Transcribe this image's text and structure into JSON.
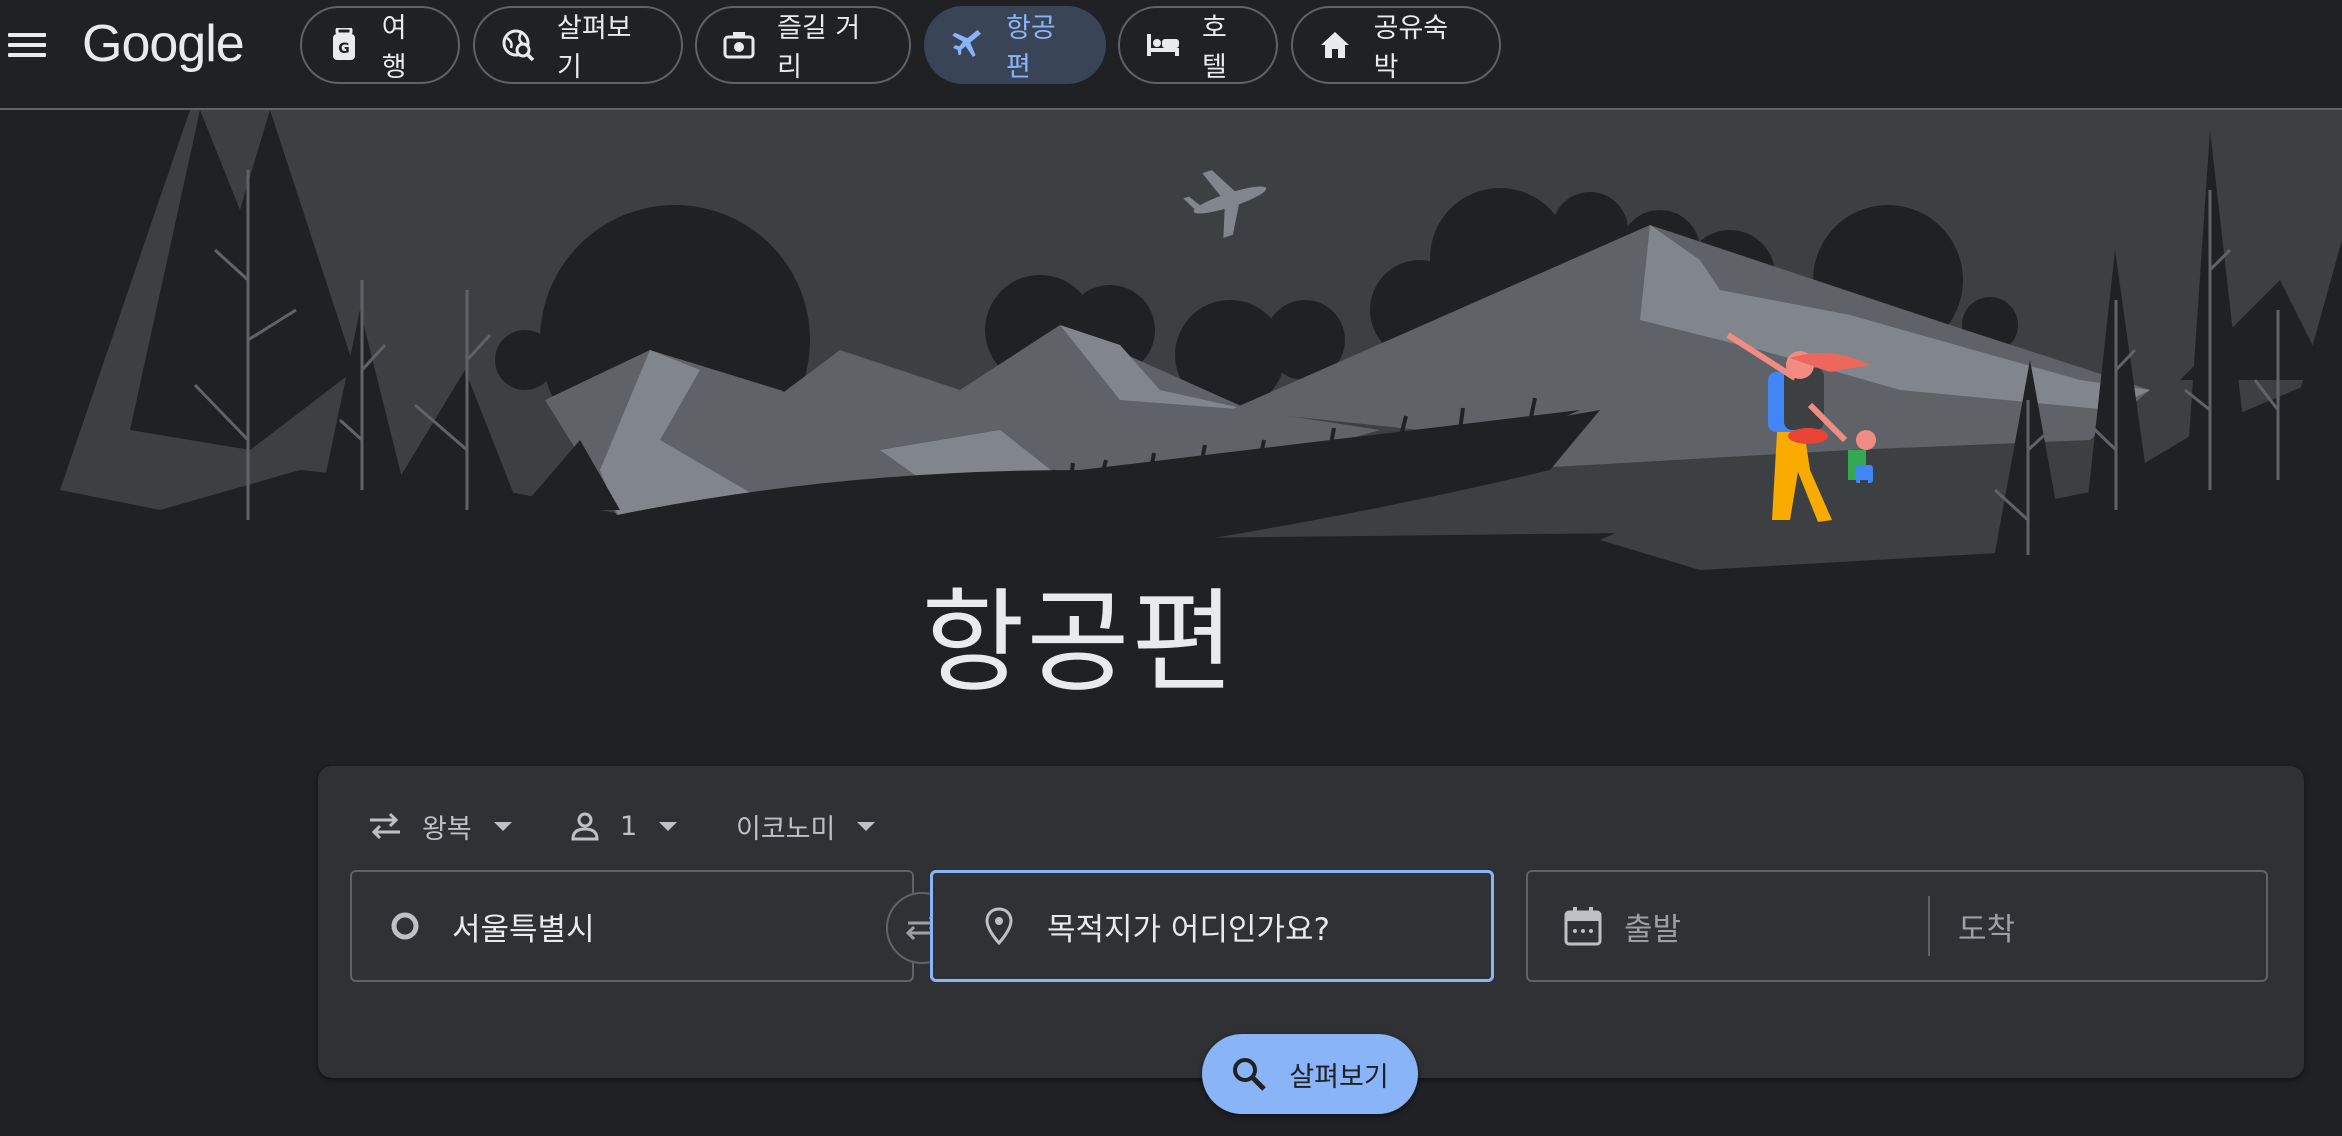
{
  "header": {
    "logo": "Google",
    "tabs": [
      {
        "label": "여행",
        "icon": "luggage-icon"
      },
      {
        "label": "살펴보기",
        "icon": "explore-globe-icon"
      },
      {
        "label": "즐길 거리",
        "icon": "camera-icon"
      },
      {
        "label": "항공편",
        "icon": "airplane-icon",
        "active": true
      },
      {
        "label": "호텔",
        "icon": "bed-icon"
      },
      {
        "label": "공유숙박",
        "icon": "home-icon"
      }
    ]
  },
  "page": {
    "title": "항공편"
  },
  "search": {
    "trip_type": "왕복",
    "passengers": "1",
    "cabin_class": "이코노미",
    "origin": "서울특별시",
    "destination_placeholder": "목적지가 어디인가요?",
    "depart_placeholder": "출발",
    "return_placeholder": "도착",
    "search_label": "살펴보기"
  },
  "colors": {
    "background": "#202124",
    "card": "#303134",
    "accent": "#8ab4f8",
    "active_tab_bg": "#394457"
  }
}
